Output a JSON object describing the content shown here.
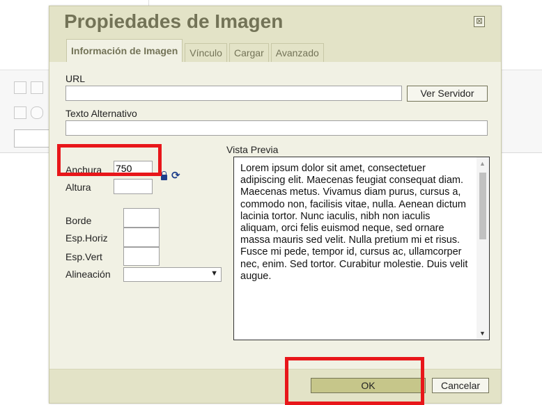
{
  "dialog": {
    "title": "Propiedades de Imagen",
    "close_symbol": "⊠",
    "tabs": [
      "Información de Imagen",
      "Vínculo",
      "Cargar",
      "Avanzado"
    ],
    "active_tab": "Información de Imagen"
  },
  "fields": {
    "url_label": "URL",
    "url_value": "",
    "browse_button": "Ver Servidor",
    "alt_label": "Texto Alternativo",
    "alt_value": "",
    "width_label": "Anchura",
    "width_value": "750",
    "height_label": "Altura",
    "height_value": "",
    "border_label": "Borde",
    "hspace_label": "Esp.Horiz",
    "vspace_label": "Esp.Vert",
    "align_label": "Alineación",
    "align_value": ""
  },
  "preview": {
    "label": "Vista Previa",
    "text": "Lorem ipsum dolor sit amet, consectetuer adipiscing elit. Maecenas feugiat consequat diam. Maecenas metus. Vivamus diam purus, cursus a, commodo non, facilisis vitae, nulla. Aenean dictum lacinia tortor. Nunc iaculis, nibh non iaculis aliquam, orci felis euismod neque, sed ornare massa mauris sed velit. Nulla pretium mi et risus. Fusce mi pede, tempor id, cursus ac, ullamcorper nec, enim. Sed tortor. Curabitur molestie. Duis velit augue."
  },
  "footer": {
    "ok_button": "OK",
    "cancel_button": "Cancelar"
  },
  "colors": {
    "dialog_bg": "#f1f1e4",
    "header_bg": "#e3e3c7",
    "title_color": "#737357",
    "highlight": "#e8161a",
    "ok_bg": "#c6c68a"
  },
  "icons": {
    "close": "close-icon",
    "lock": "lock-ratio-icon",
    "reset": "reset-size-icon",
    "select_arrow": "dropdown-arrow-icon"
  }
}
